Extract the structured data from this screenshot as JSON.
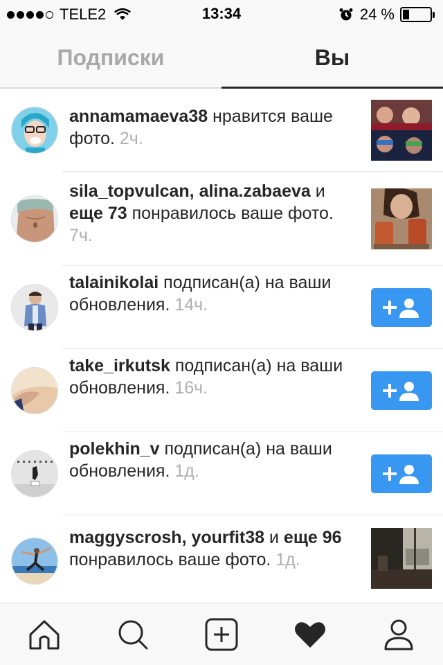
{
  "status_bar": {
    "carrier": "TELE2",
    "time": "13:34",
    "battery_percent": "24 %",
    "battery_level": 0.24,
    "signal_bars": 4
  },
  "tabs": [
    {
      "label": "Подписки",
      "active": false
    },
    {
      "label": "Вы",
      "active": true
    }
  ],
  "notifications": [
    {
      "user": "annamamaeva38",
      "action": " нравится ваше фото.",
      "time": "2ч."
    },
    {
      "users_1": "sila_topvulcan",
      "sep_1": ", ",
      "users_2": "alina.zabaeva",
      "and": " и ",
      "more": "еще 73",
      "action": " понравилось ваше фото.",
      "time": "7ч."
    },
    {
      "user": "talainikolai",
      "action": " подписан(а) на ваши обновления.",
      "time": "14ч.",
      "follow_icon": "add-user-icon"
    },
    {
      "user": "take_irkutsk",
      "action": " подписан(а) на ваши обновления.",
      "time": "16ч.",
      "follow_icon": "add-user-icon"
    },
    {
      "user": "polekhin_v",
      "action": " подписан(а) на ваши обновления.",
      "time": "1д.",
      "follow_icon": "add-user-icon"
    },
    {
      "users_1": "maggyscrosh",
      "sep_1": ", ",
      "users_2": "yourfit38",
      "and": " и ",
      "more": "еще 96",
      "action": " понравилось ваше фото.",
      "time": "1д."
    }
  ],
  "bottom_nav": [
    "home-icon",
    "search-icon",
    "add-post-icon",
    "heart-icon",
    "profile-icon"
  ],
  "colors": {
    "accent_blue": "#3897f0",
    "text": "#262626",
    "muted": "#b0b0b0"
  }
}
